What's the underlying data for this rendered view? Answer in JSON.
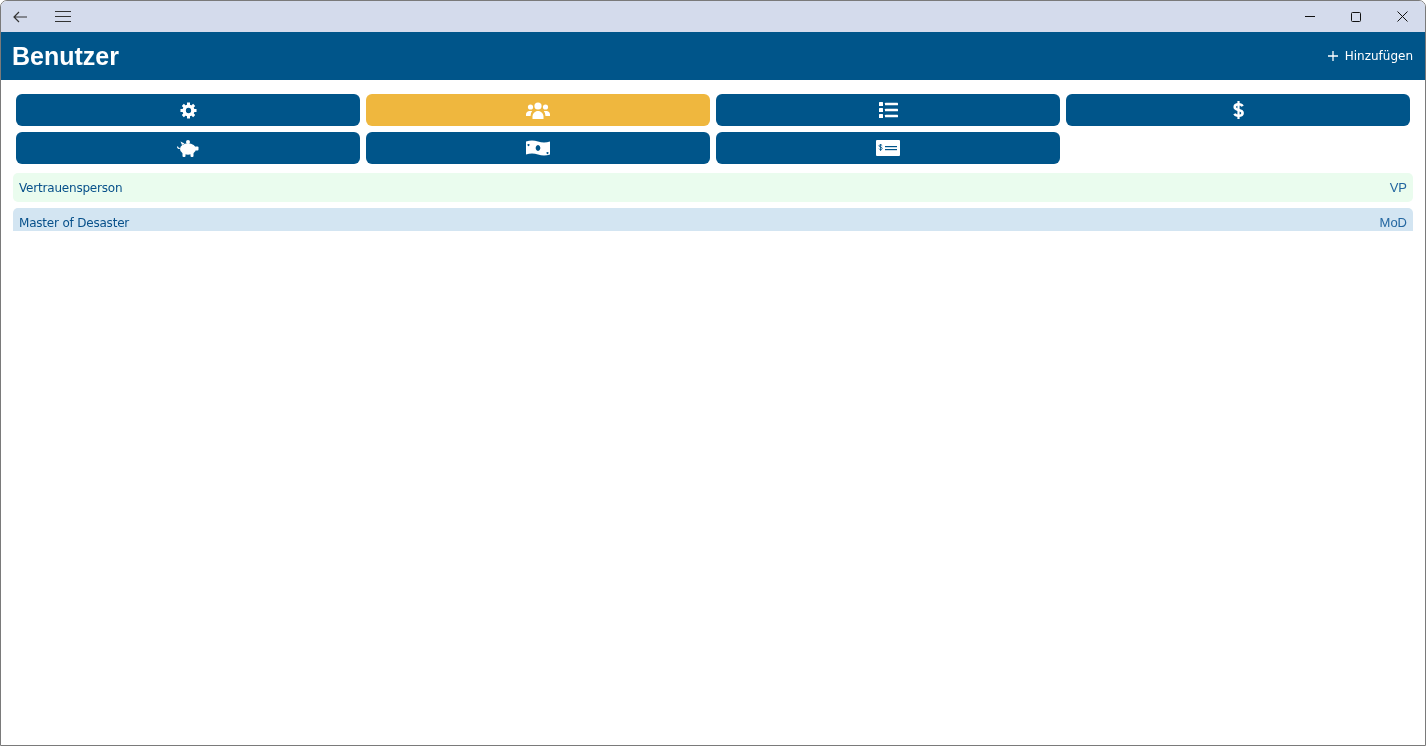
{
  "header": {
    "title": "Benutzer",
    "add_button": "Hinzufügen"
  },
  "tabs": [
    {
      "selected": false
    },
    {
      "selected": true
    },
    {
      "selected": false
    },
    {
      "selected": false
    },
    {
      "selected": false
    },
    {
      "selected": false
    },
    {
      "selected": false
    }
  ],
  "list": [
    {
      "name": "Vertrauensperson",
      "abbreviation": "VP",
      "color": "#eafcee"
    },
    {
      "name": "Master of Desaster",
      "abbreviation": "MoD",
      "color": "#d3e5f2"
    }
  ]
}
